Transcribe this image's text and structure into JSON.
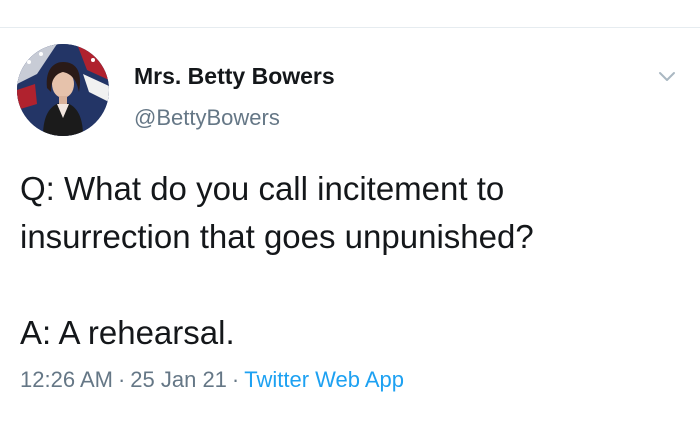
{
  "tweet": {
    "author": {
      "display_name": "Mrs. Betty Bowers",
      "handle": "@BettyBowers"
    },
    "text_lines": [
      "Q: What do you call incitement to",
      "insurrection that goes unpunished?",
      "A: A rehearsal."
    ],
    "meta": {
      "time": "12:26 AM",
      "separator": "·",
      "date": "25 Jan 21",
      "source": "Twitter Web App"
    }
  },
  "icons": {
    "menu": "chevron-down-icon",
    "avatar": "avatar"
  },
  "colors": {
    "text": "#14171a",
    "secondary": "#657786",
    "link": "#1da1f2",
    "divider": "#e6ecf0"
  }
}
